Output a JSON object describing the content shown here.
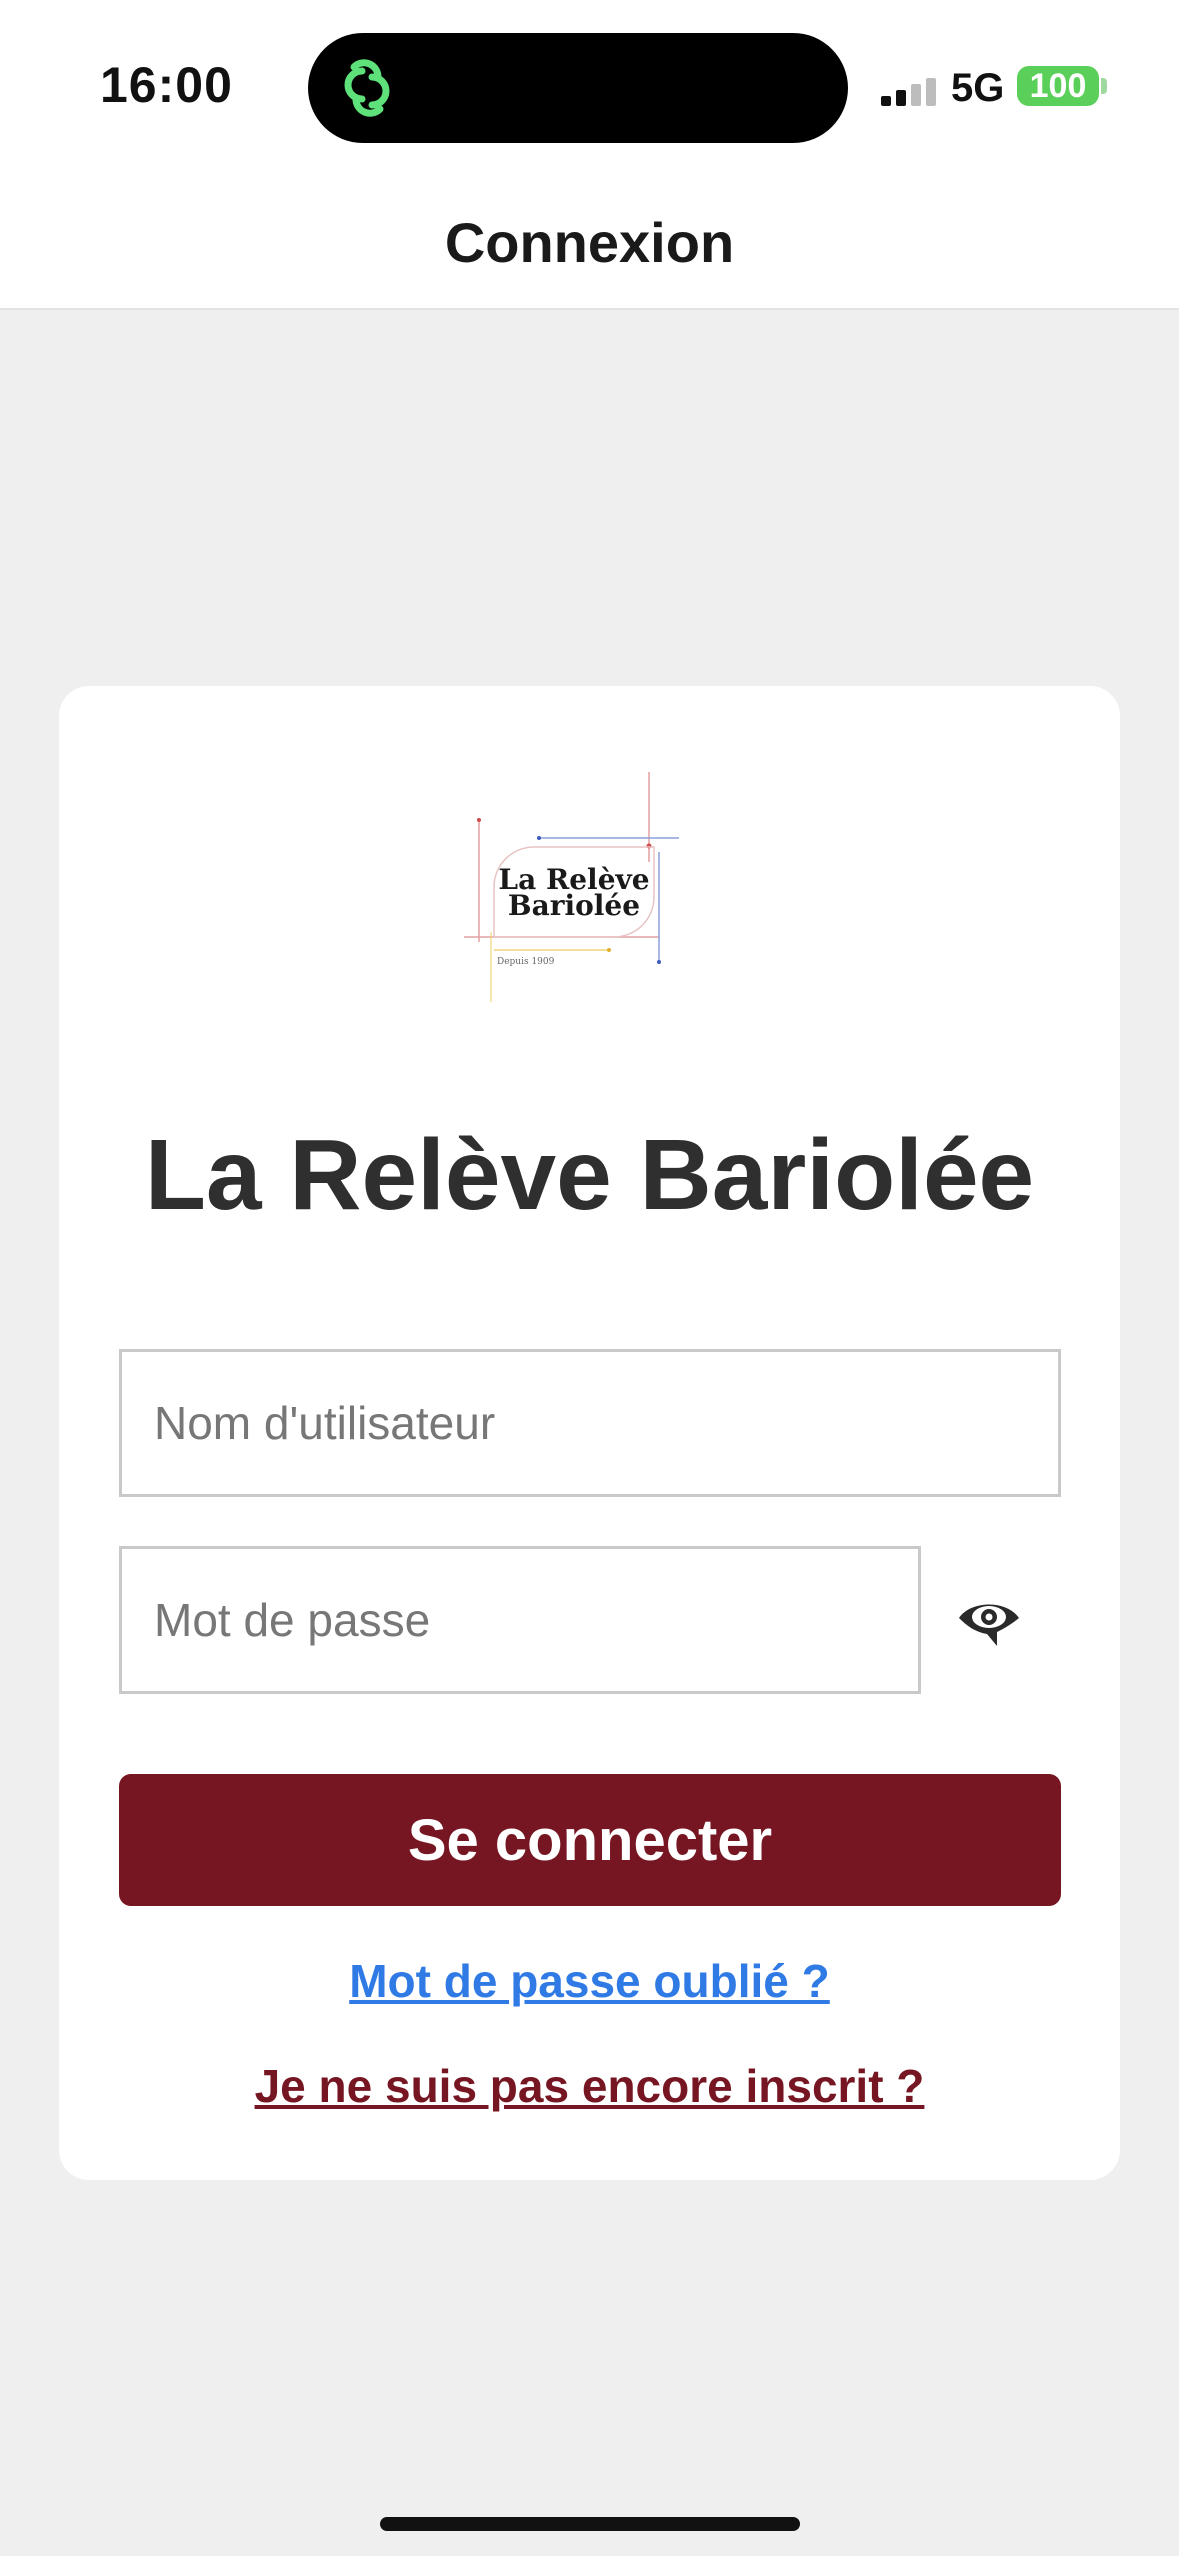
{
  "status_bar": {
    "time": "16:00",
    "network": "5G",
    "battery": "100"
  },
  "nav": {
    "title": "Connexion"
  },
  "logo": {
    "line1": "La Relève",
    "line2": "Bariolée",
    "tagline": "Depuis 1909"
  },
  "login": {
    "app_title": "La Relève Bariolée",
    "username_placeholder": "Nom d'utilisateur",
    "password_placeholder": "Mot de passe",
    "submit_label": "Se connecter",
    "forgot_label": "Mot de passe oublié ?",
    "register_label": "Je ne suis pas encore inscrit ?"
  },
  "colors": {
    "primary": "#761622",
    "link": "#2f7ae5",
    "battery": "#5ad05a",
    "island_icon": "#5ee07a"
  }
}
